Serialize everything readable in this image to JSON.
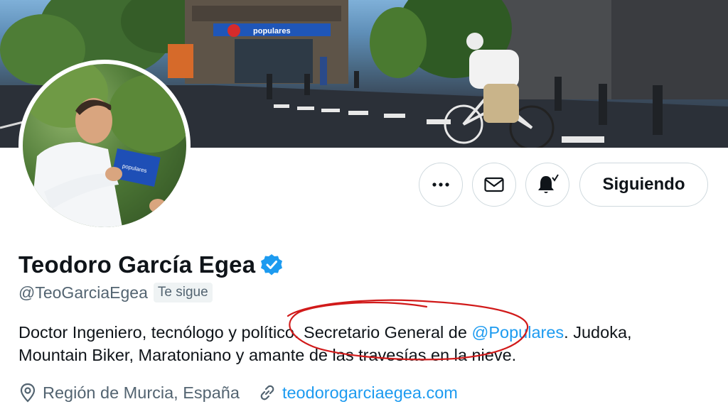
{
  "banner": {
    "storefront_sign": "populares",
    "badge_text": "pp"
  },
  "avatar": {
    "card_text": "populares"
  },
  "actions": {
    "more_label": "•••",
    "follow_label": "Siguiendo"
  },
  "profile": {
    "display_name": "Teodoro García Egea",
    "handle": "@TeoGarciaEgea",
    "follows_you": "Te sigue",
    "bio": {
      "part1": "Doctor Ingeniero, tecnólogo y político. Secretario General de ",
      "mention": "@Populares",
      "part2": ". Judoka,",
      "line2": "Mountain Biker, Maratoniano y amante de las travesías en la nieve."
    },
    "location": "Región de Murcia, España",
    "website": "teodorogarciaegea.com"
  },
  "colors": {
    "accent": "#1d9bf0",
    "secondary_text": "#536471",
    "annotation": "#d11a1a"
  },
  "icons": [
    "more-icon",
    "mail-icon",
    "bell-notify-icon",
    "verified-icon",
    "location-icon",
    "link-icon"
  ]
}
